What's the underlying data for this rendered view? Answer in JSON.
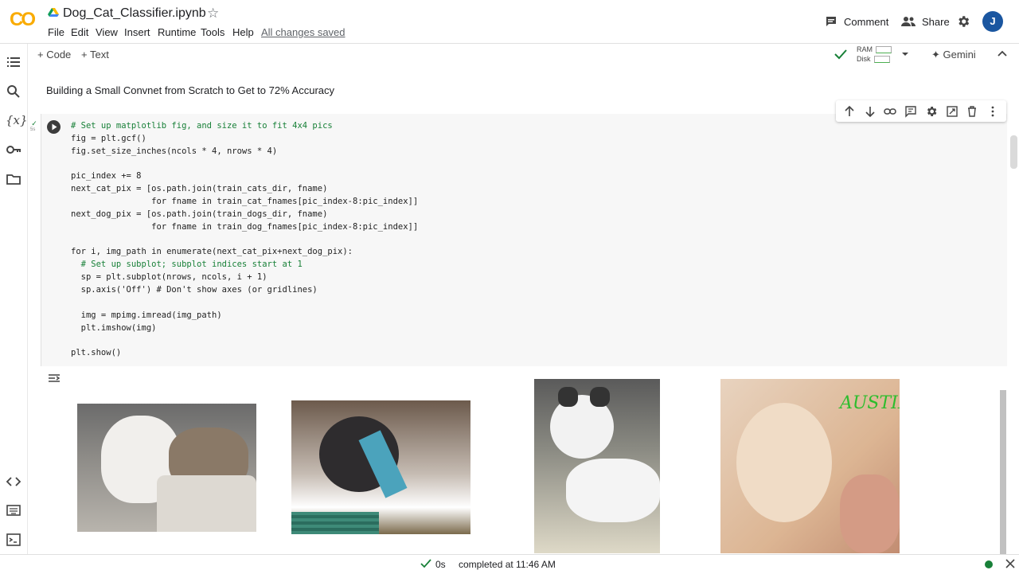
{
  "app": {
    "logo": "CO",
    "notebook_title": "Dog_Cat_Classifier.ipynb",
    "avatar_initial": "J",
    "saved_status": "All changes saved"
  },
  "menu": [
    "File",
    "Edit",
    "View",
    "Insert",
    "Runtime",
    "Tools",
    "Help"
  ],
  "header_actions": {
    "comment_label": "Comment",
    "share_label": "Share"
  },
  "toolbar": {
    "code_label": "+ Code",
    "text_label": "+ Text",
    "ram_label": "RAM",
    "disk_label": "Disk",
    "gemini_label": "Gemini"
  },
  "text_cell": {
    "heading": "Building a Small Convnet from Scratch to Get to 72% Accuracy"
  },
  "code_cell": {
    "exec_time": "5s",
    "lines": [
      "# Set up matplotlib fig, and size it to fit 4x4 pics",
      "fig = plt.gcf()",
      "fig.set_size_inches(ncols * 4, nrows * 4)",
      "",
      "pic_index += 8",
      "next_cat_pix = [os.path.join(train_cats_dir, fname)",
      "                for fname in train_cat_fnames[pic_index-8:pic_index]]",
      "next_dog_pix = [os.path.join(train_dogs_dir, fname)",
      "                for fname in train_dog_fnames[pic_index-8:pic_index]]",
      "",
      "for i, img_path in enumerate(next_cat_pix+next_dog_pix):",
      "  # Set up subplot; subplot indices start at 1",
      "  sp = plt.subplot(nrows, ncols, i + 1)",
      "  sp.axis('Off') # Don't show axes (or gridlines)",
      "",
      "  img = mpimg.imread(img_path)",
      "  plt.imshow(img)",
      "",
      "plt.show()"
    ]
  },
  "output": {
    "watermark_text": "AUSTIN"
  },
  "status_bar": {
    "duration": "0s",
    "completed_text": "completed at 11:46 AM"
  },
  "colors": {
    "accent_blue": "#1a56a0",
    "success_green": "#188038",
    "logo_orange": "#f9ab00"
  }
}
